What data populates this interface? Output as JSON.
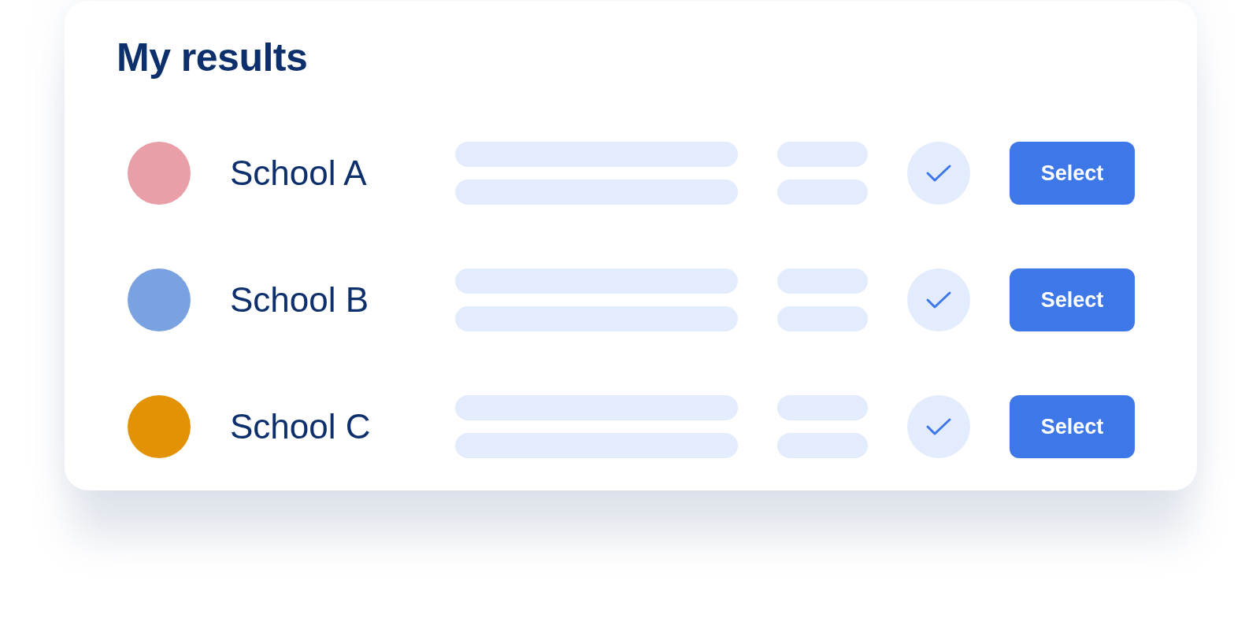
{
  "title": "My results",
  "schools": [
    {
      "name": "School A",
      "color": "#e89fa8",
      "button": "Select"
    },
    {
      "name": "School B",
      "color": "#7ba2e0",
      "button": "Select"
    },
    {
      "name": "School C",
      "color": "#e39205",
      "button": "Select"
    }
  ]
}
